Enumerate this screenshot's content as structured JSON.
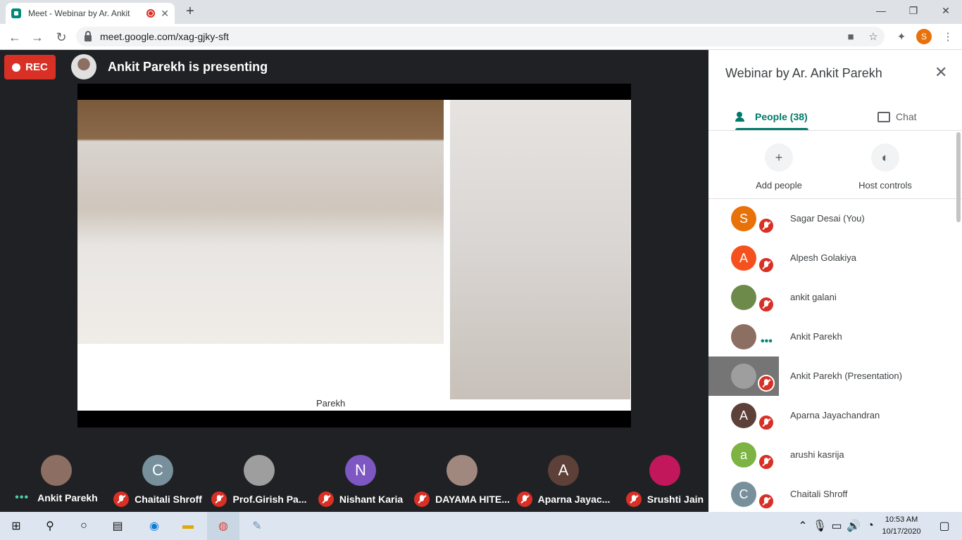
{
  "browser": {
    "tab_title": "Meet - Webinar by Ar. Ankit",
    "new_tab": "+",
    "url": "meet.google.com/xag-gjky-sft",
    "profile_initial": "S",
    "window_controls": {
      "minimize": "—",
      "restore": "❐",
      "close": "✕"
    },
    "icons": [
      "back-icon",
      "forward-icon",
      "reload-icon",
      "lock-icon",
      "camera-icon",
      "star-icon",
      "extensions-icon",
      "menu-icon"
    ]
  },
  "meet": {
    "rec_label": "REC",
    "presenting_text": "Ankit Parekh is presenting",
    "slide_logo": "Parekh"
  },
  "filmstrip": [
    {
      "name": "Ankit Parekh",
      "initial": "",
      "avatar_color": "#8d6e63",
      "speaking": true
    },
    {
      "name": "Chaitali Shroff",
      "initial": "C",
      "avatar_color": "#78909c",
      "speaking": false
    },
    {
      "name": "Prof.Girish Pa...",
      "initial": "",
      "avatar_color": "#9e9e9e",
      "speaking": false
    },
    {
      "name": "Nishant Karia",
      "initial": "N",
      "avatar_color": "#7e57c2",
      "speaking": false
    },
    {
      "name": "DAYAMA HITE...",
      "initial": "",
      "avatar_color": "#a1887f",
      "speaking": false
    },
    {
      "name": "Aparna Jayac...",
      "initial": "A",
      "avatar_color": "#5d4037",
      "speaking": false
    },
    {
      "name": "Srushti Jain",
      "initial": "",
      "avatar_color": "#c2185b",
      "speaking": false
    }
  ],
  "panel": {
    "title": "Webinar by Ar. Ankit Parekh",
    "tab_people": "People (38)",
    "tab_chat": "Chat",
    "add_people": "Add people",
    "host_controls": "Host controls",
    "people": [
      {
        "name": "Sagar Desai (You)",
        "initial": "S",
        "color": "#e8710a",
        "status": "muted"
      },
      {
        "name": "Alpesh Golakiya",
        "initial": "A",
        "color": "#f4511e",
        "status": "muted"
      },
      {
        "name": "ankit galani",
        "initial": "",
        "color": "#6d8a4a",
        "status": "muted"
      },
      {
        "name": "Ankit Parekh",
        "initial": "",
        "color": "#8d6e63",
        "status": "speaking"
      },
      {
        "name": "Ankit Parekh (Presentation)",
        "initial": "",
        "color": "#9e9e9e",
        "status": "muted"
      },
      {
        "name": "Aparna Jayachandran",
        "initial": "A",
        "color": "#5d4037",
        "status": "muted"
      },
      {
        "name": "arushi kasrija",
        "initial": "a",
        "color": "#7cb342",
        "status": "muted"
      },
      {
        "name": "Chaitali Shroff",
        "initial": "C",
        "color": "#78909c",
        "status": "muted"
      }
    ]
  },
  "taskbar": {
    "time": "10:53 AM",
    "date": "10/17/2020"
  }
}
